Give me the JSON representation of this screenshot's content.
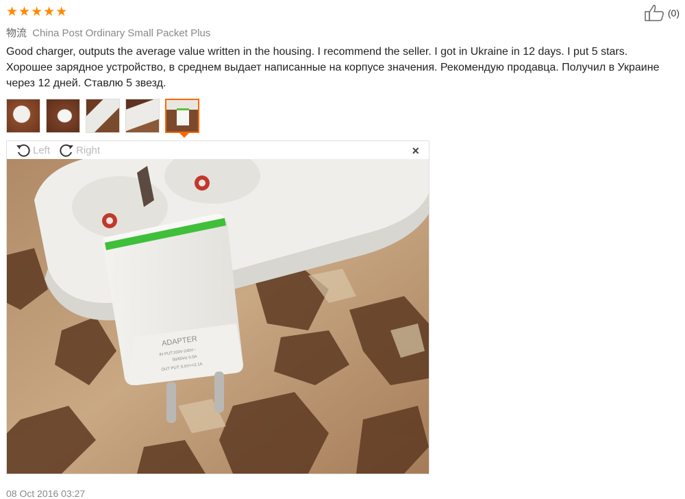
{
  "rating": {
    "stars": 5,
    "star_glyph": "★",
    "color": "#ff8a00"
  },
  "helpful": {
    "icon": "thumbs-up-icon",
    "count_label": "(0)"
  },
  "shipping": {
    "label_cn": "物流",
    "method": "China Post Ordinary Small Packet Plus"
  },
  "review": {
    "english": "Good charger, outputs the average value written in the housing. I recommend the seller. I got in Ukraine in 12 days. I put 5 stars.",
    "russian": "Хорошее зарядное устройство, в среднем выдает написанные на корпусе значения. Рекомендую продавца. Получил в Украине через 12 дней. Ставлю 5 звезд."
  },
  "thumbnails": {
    "count": 5,
    "active_index": 4,
    "accent": "#ff6600"
  },
  "viewer": {
    "rotate_left_label": "Left",
    "rotate_right_label": "Right",
    "close_glyph": "×",
    "photo_text": {
      "adapter": "ADAPTER",
      "input": "IN PUT:100V-240V~",
      "freq": "50/60Hz 0.5A",
      "output": "OUT PUT: 5.0V==2.1A"
    }
  },
  "date": "08 Oct 2016 03:27"
}
